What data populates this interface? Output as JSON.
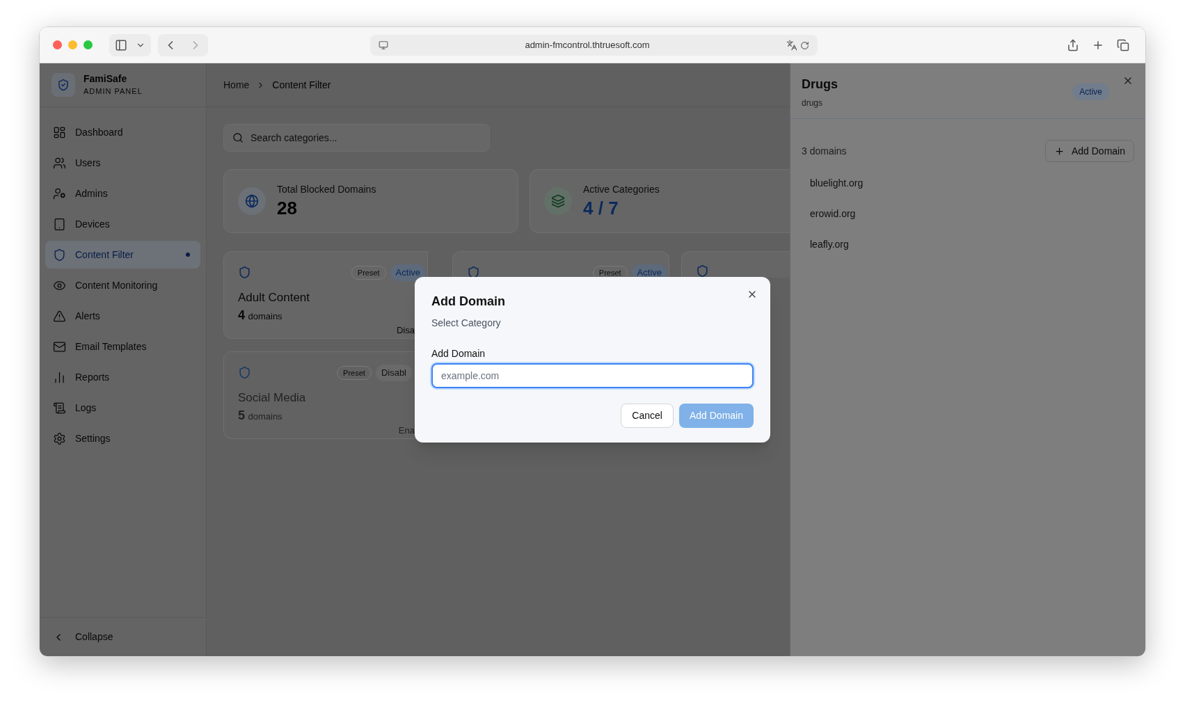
{
  "browser": {
    "url": "admin-fmcontrol.thtruesoft.com"
  },
  "sidebar": {
    "brand": {
      "name": "FamiSafe",
      "subtitle": "ADMIN PANEL"
    },
    "items": [
      {
        "label": "Dashboard",
        "selected": false
      },
      {
        "label": "Users",
        "selected": false
      },
      {
        "label": "Admins",
        "selected": false
      },
      {
        "label": "Devices",
        "selected": false
      },
      {
        "label": "Content Filter",
        "selected": true
      },
      {
        "label": "Content Monitoring",
        "selected": false
      },
      {
        "label": "Alerts",
        "selected": false
      },
      {
        "label": "Email Templates",
        "selected": false
      },
      {
        "label": "Reports",
        "selected": false
      },
      {
        "label": "Logs",
        "selected": false
      },
      {
        "label": "Settings",
        "selected": false
      }
    ],
    "collapse": "Collapse"
  },
  "breadcrumb": [
    "Home",
    "Content Filter"
  ],
  "search": {
    "placeholder": "Search categories..."
  },
  "stats": [
    {
      "label": "Total Blocked Domains",
      "value": "28",
      "kind": "globe"
    },
    {
      "label": "Active Categories",
      "value": "4 / 7",
      "kind": "layers"
    }
  ],
  "categories": [
    {
      "kind": "full",
      "enabled": true,
      "badges": [
        {
          "text": "Preset",
          "kind": "outline"
        },
        {
          "text": "Active",
          "kind": "active"
        }
      ],
      "title": "Adult Content",
      "count": "4",
      "count_label": "domains",
      "footer": "Disa"
    },
    {
      "kind": "top",
      "badges": [
        {
          "text": "Preset",
          "kind": "outline"
        },
        {
          "text": "Active",
          "kind": "active"
        }
      ]
    },
    {
      "kind": "top"
    },
    {
      "kind": "full",
      "enabled": false,
      "badges": [
        {
          "text": "Preset",
          "kind": "outline"
        },
        {
          "text": "Disabl",
          "kind": "muted"
        }
      ],
      "title": "Social Media",
      "count": "5",
      "count_label": "domains",
      "footer": "Ena"
    }
  ],
  "sheet": {
    "title": "Drugs",
    "slug": "drugs",
    "status": "Active",
    "count_text": "3 domains",
    "add_button": "Add Domain",
    "domains": [
      "bluelight.org",
      "erowid.org",
      "leafly.org"
    ]
  },
  "dialog": {
    "title": "Add Domain",
    "subtitle": "Select Category",
    "field_label": "Add Domain",
    "placeholder": "example.com",
    "buttons": [
      {
        "label": "Cancel",
        "kind": "secondary",
        "disabled": false
      },
      {
        "label": "Add Domain",
        "kind": "primary",
        "disabled": true
      }
    ]
  }
}
